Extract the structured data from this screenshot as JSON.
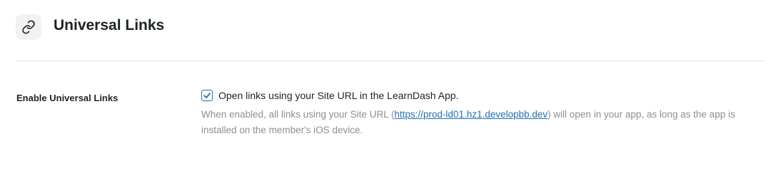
{
  "header": {
    "icon": "link-icon",
    "title": "Universal Links"
  },
  "setting": {
    "label": "Enable Universal Links",
    "checkbox_checked": true,
    "checkbox_label": "Open links using your Site URL in the LearnDash App.",
    "description_prefix": "When enabled, all links using your Site URL (",
    "description_link": "https://prod-ld01.hz1.developbb.dev",
    "description_suffix": ") will open in your app, as long as the app is installed on the member's iOS device."
  },
  "colors": {
    "accent": "#2271b1",
    "muted_text": "#8c8f94",
    "icon_bg": "#f2f2f2"
  }
}
